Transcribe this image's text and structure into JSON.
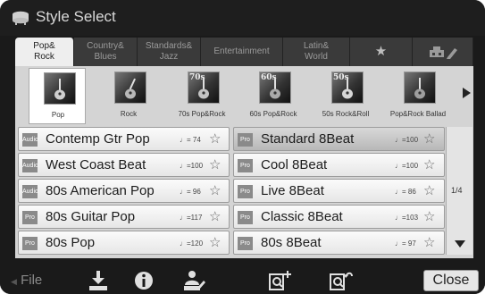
{
  "window": {
    "title": "Style Select"
  },
  "tabs": [
    {
      "label": "Pop&\nRock",
      "active": true
    },
    {
      "label": "Country&\nBlues",
      "active": false
    },
    {
      "label": "Standards&\nJazz",
      "active": false
    },
    {
      "label": "Entertainment",
      "active": false
    },
    {
      "label": "Latin&\nWorld",
      "active": false
    },
    {
      "label": "★",
      "active": false
    },
    {
      "label": "",
      "active": false
    }
  ],
  "subcategories": [
    {
      "label": "Pop",
      "badge": "",
      "active": true
    },
    {
      "label": "Rock",
      "badge": "",
      "active": false
    },
    {
      "label": "70s Pop&Rock",
      "badge": "70s",
      "active": false
    },
    {
      "label": "60s Pop&Rock",
      "badge": "60s",
      "active": false
    },
    {
      "label": "50s Rock&Roll",
      "badge": "50s",
      "active": false
    },
    {
      "label": "Pop&Rock Ballad",
      "badge": "",
      "active": false
    }
  ],
  "styles_left": [
    {
      "type": "Audio",
      "name": "Contemp Gtr Pop",
      "tempo": "♩= 74",
      "star": "☆",
      "selected": false
    },
    {
      "type": "Audio",
      "name": "West Coast Beat",
      "tempo": "♩=100",
      "star": "☆",
      "selected": false
    },
    {
      "type": "Audio",
      "name": "80s American Pop",
      "tempo": "♩= 96",
      "star": "☆",
      "selected": false
    },
    {
      "type": "Pro",
      "name": "80s Guitar Pop",
      "tempo": "♩=117",
      "star": "☆",
      "selected": false
    },
    {
      "type": "Pro",
      "name": "80s Pop",
      "tempo": "♩=120",
      "star": "☆",
      "selected": false
    }
  ],
  "styles_right": [
    {
      "type": "Pro",
      "name": "Standard 8Beat",
      "tempo": "♩=100",
      "star": "☆",
      "selected": true
    },
    {
      "type": "Pro",
      "name": "Cool 8Beat",
      "tempo": "♩=100",
      "star": "☆",
      "selected": false
    },
    {
      "type": "Pro",
      "name": "Live 8Beat",
      "tempo": "♩= 86",
      "star": "☆",
      "selected": false
    },
    {
      "type": "Pro",
      "name": "Classic 8Beat",
      "tempo": "♩=103",
      "star": "☆",
      "selected": false
    },
    {
      "type": "Pro",
      "name": "80s 8Beat",
      "tempo": "♩= 97",
      "star": "☆",
      "selected": false
    }
  ],
  "pager": {
    "indicator": "1/4"
  },
  "bottom": {
    "file_label": "File",
    "close_label": "Close",
    "icons": [
      "save-icon",
      "info-icon",
      "user-style-icon",
      "search-add-icon",
      "search-back-icon"
    ]
  },
  "colors": {
    "background": "#1a1a1a",
    "panel": "#d4d4d4",
    "selected_row": "#bcbcbc"
  }
}
